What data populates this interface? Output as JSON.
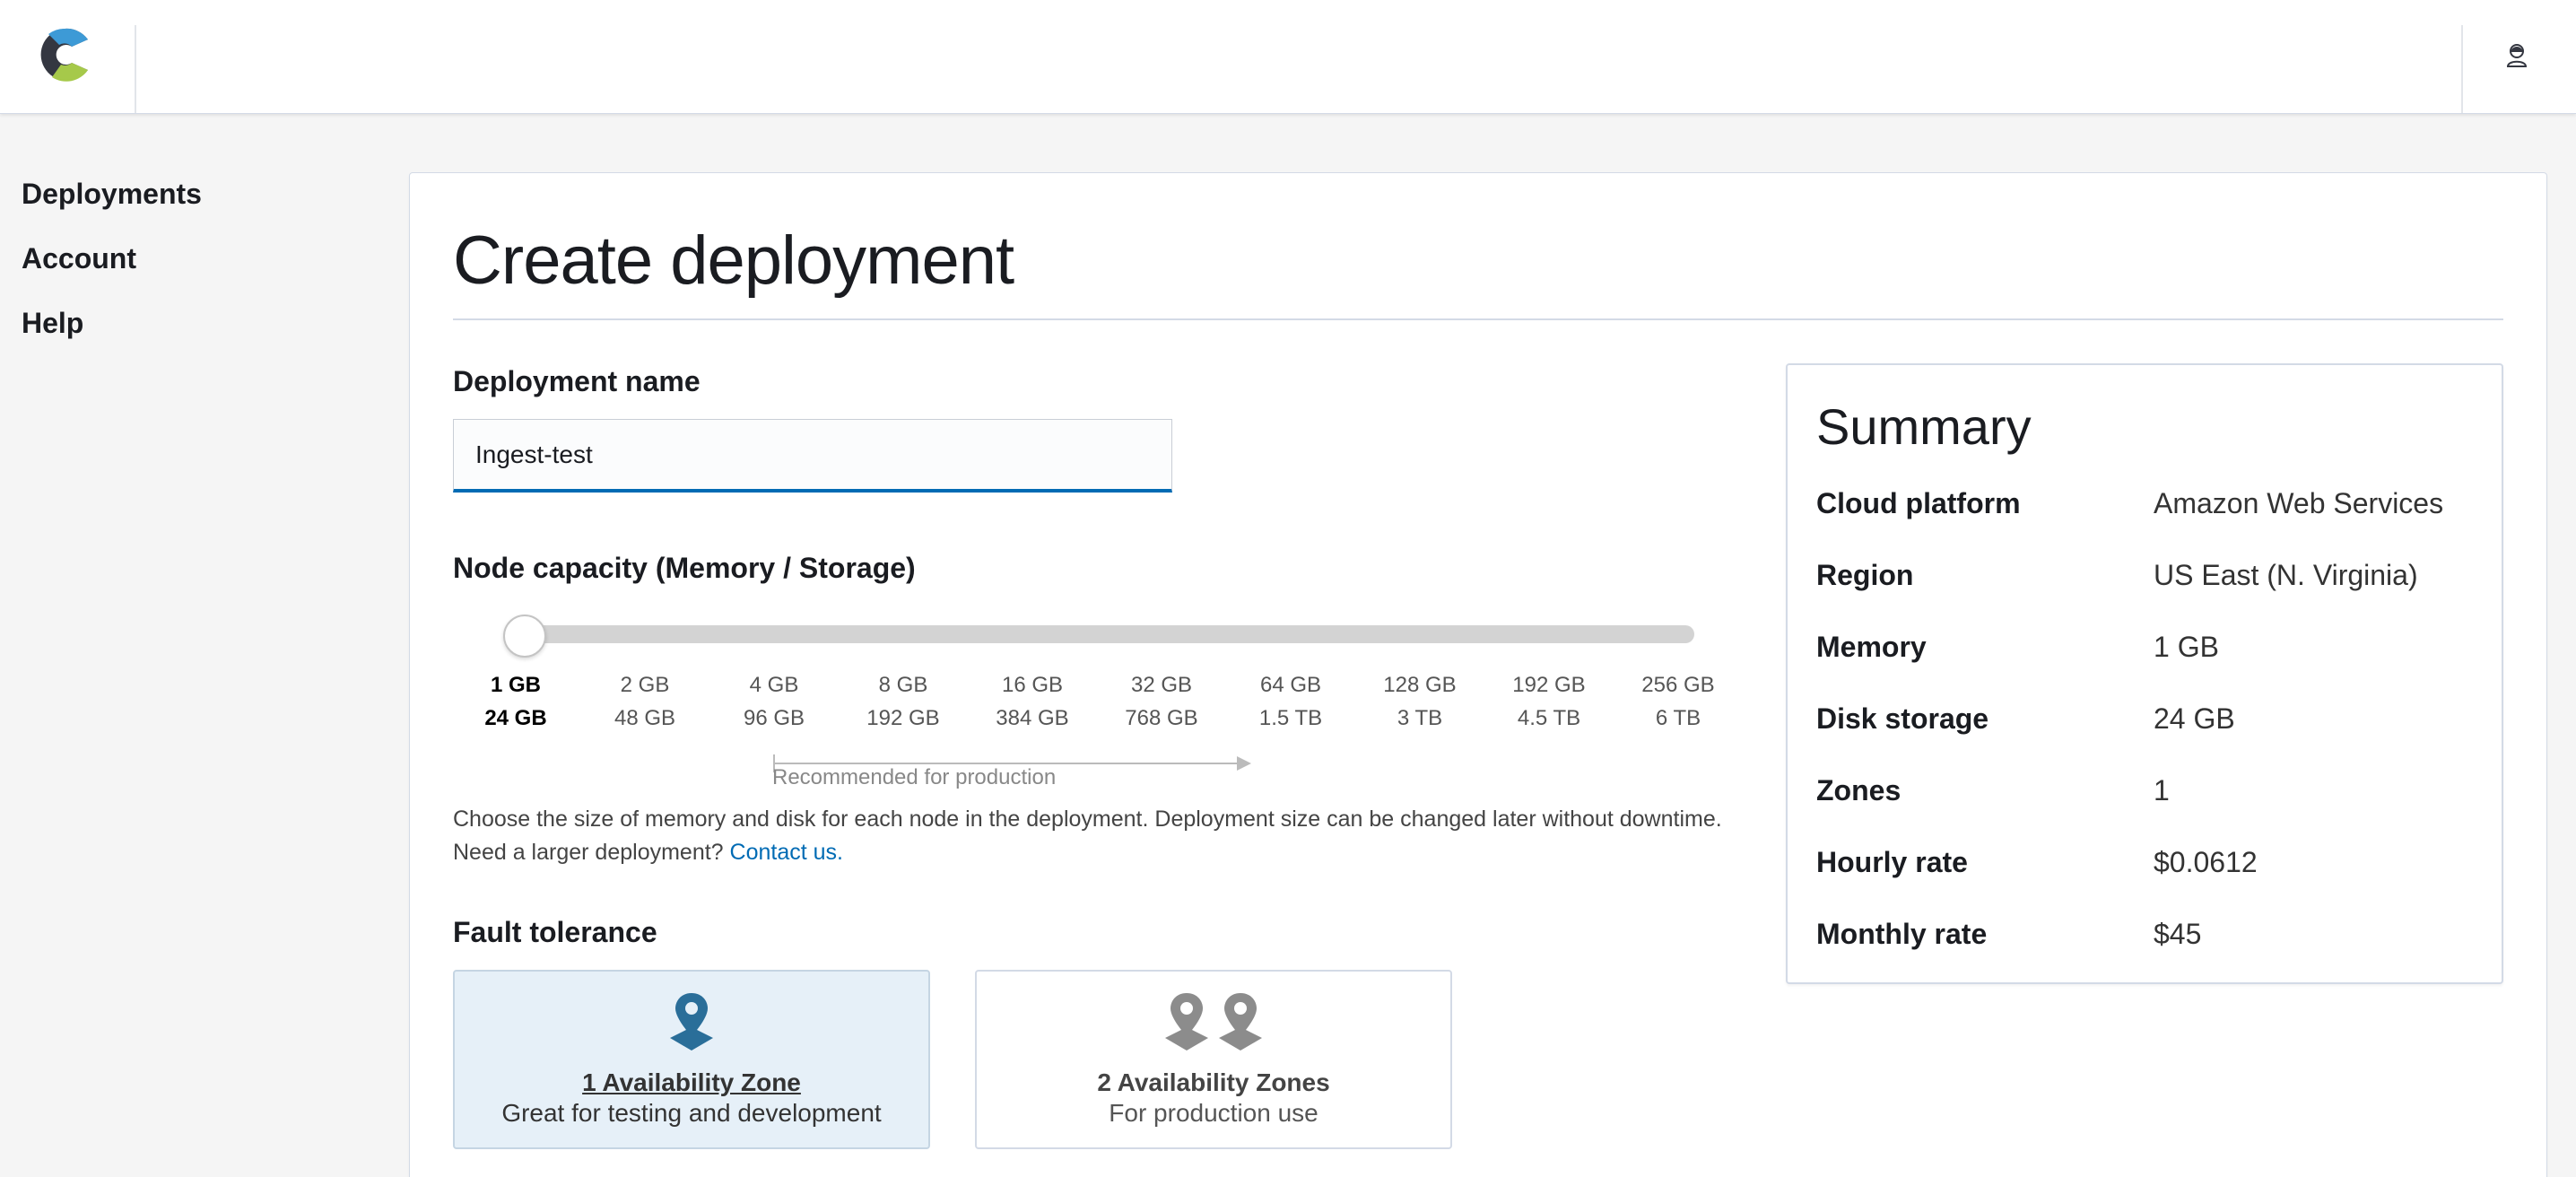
{
  "header": {
    "logo_icon": "elastic-cloud-logo-icon",
    "user_icon": "user-icon",
    "colors": {
      "logo_dark": "#343741",
      "logo_blue": "#3ebeb0",
      "logo_green": "#a6c94a"
    }
  },
  "sidebar": {
    "items": [
      {
        "label": "Deployments"
      },
      {
        "label": "Account"
      },
      {
        "label": "Help"
      }
    ]
  },
  "main": {
    "title": "Create deployment",
    "deployment_name": {
      "label": "Deployment name",
      "value": "Ingest-test"
    },
    "node_capacity": {
      "label": "Node capacity (Memory / Storage)",
      "selected_index": 0,
      "options": [
        {
          "memory": "1 GB",
          "storage": "24 GB"
        },
        {
          "memory": "2 GB",
          "storage": "48 GB"
        },
        {
          "memory": "4 GB",
          "storage": "96 GB"
        },
        {
          "memory": "8 GB",
          "storage": "192 GB"
        },
        {
          "memory": "16 GB",
          "storage": "384 GB"
        },
        {
          "memory": "32 GB",
          "storage": "768 GB"
        },
        {
          "memory": "64 GB",
          "storage": "1.5 TB"
        },
        {
          "memory": "128 GB",
          "storage": "3 TB"
        },
        {
          "memory": "192 GB",
          "storage": "4.5 TB"
        },
        {
          "memory": "256 GB",
          "storage": "6 TB"
        }
      ],
      "recommended_label": "Recommended for production",
      "help_text": "Choose the size of memory and disk for each node in the deployment. Deployment size can be changed later without downtime. Need a larger deployment?",
      "contact_link": "Contact us."
    },
    "fault_tolerance": {
      "label": "Fault tolerance",
      "options": [
        {
          "title": "1 Availability Zone",
          "description": "Great for testing and development",
          "selected": true,
          "icon": "map-pin-icon"
        },
        {
          "title": "2 Availability Zones",
          "description": "For production use",
          "selected": false,
          "icon": "map-pin-icon"
        }
      ]
    },
    "accent_color": "#006bb4"
  },
  "summary": {
    "title": "Summary",
    "rows": [
      {
        "key": "Cloud platform",
        "value": "Amazon Web Services"
      },
      {
        "key": "Region",
        "value": "US East (N. Virginia)"
      },
      {
        "key": "Memory",
        "value": "1 GB"
      },
      {
        "key": "Disk storage",
        "value": "24 GB"
      },
      {
        "key": "Zones",
        "value": "1"
      },
      {
        "key": "Hourly rate",
        "value": "$0.0612"
      },
      {
        "key": "Monthly rate",
        "value": "$45"
      }
    ]
  }
}
